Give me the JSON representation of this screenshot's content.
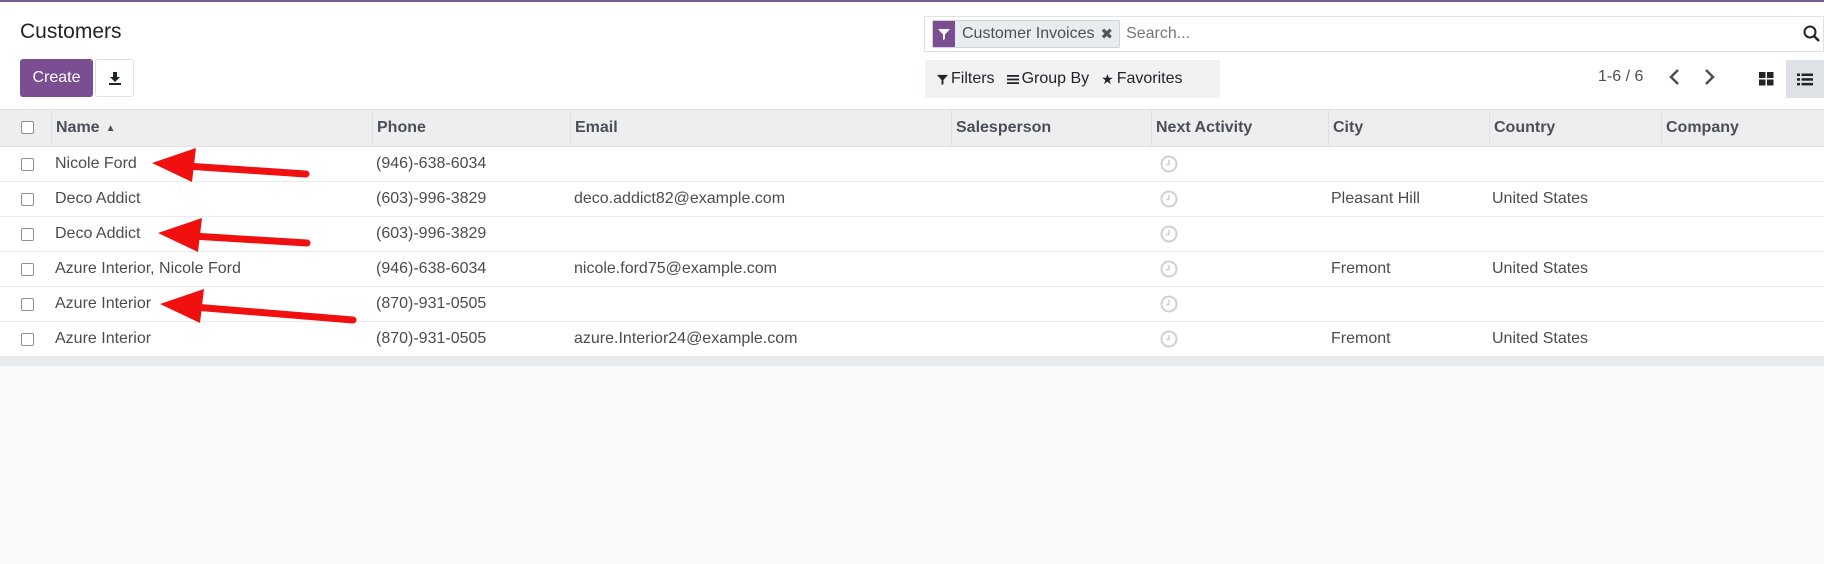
{
  "header": {
    "title": "Customers",
    "create_label": "Create"
  },
  "search": {
    "facet_label": "Customer Invoices",
    "placeholder": "Search..."
  },
  "filters": {
    "filters_label": "Filters",
    "group_by_label": "Group By",
    "favorites_label": "Favorites"
  },
  "pager": {
    "value": "1-6 / 6"
  },
  "table": {
    "columns": [
      "Name",
      "Phone",
      "Email",
      "Salesperson",
      "Next Activity",
      "City",
      "Country",
      "Company"
    ],
    "rows": [
      {
        "name": "Nicole Ford",
        "phone": "(946)-638-6034",
        "email": "",
        "salesperson": "",
        "city": "",
        "country": "",
        "company": ""
      },
      {
        "name": "Deco Addict",
        "phone": "(603)-996-3829",
        "email": "deco.addict82@example.com",
        "salesperson": "",
        "city": "Pleasant Hill",
        "country": "United States",
        "company": ""
      },
      {
        "name": "Deco Addict",
        "phone": "(603)-996-3829",
        "email": "",
        "salesperson": "",
        "city": "",
        "country": "",
        "company": ""
      },
      {
        "name": "Azure Interior, Nicole Ford",
        "phone": "(946)-638-6034",
        "email": "nicole.ford75@example.com",
        "salesperson": "",
        "city": "Fremont",
        "country": "United States",
        "company": ""
      },
      {
        "name": "Azure Interior",
        "phone": "(870)-931-0505",
        "email": "",
        "salesperson": "",
        "city": "",
        "country": "",
        "company": ""
      },
      {
        "name": "Azure Interior",
        "phone": "(870)-931-0505",
        "email": "azure.Interior24@example.com",
        "salesperson": "",
        "city": "Fremont",
        "country": "United States",
        "company": ""
      }
    ]
  },
  "colors": {
    "brand": "#7a4e91",
    "annotation_arrow": "#f01010"
  }
}
